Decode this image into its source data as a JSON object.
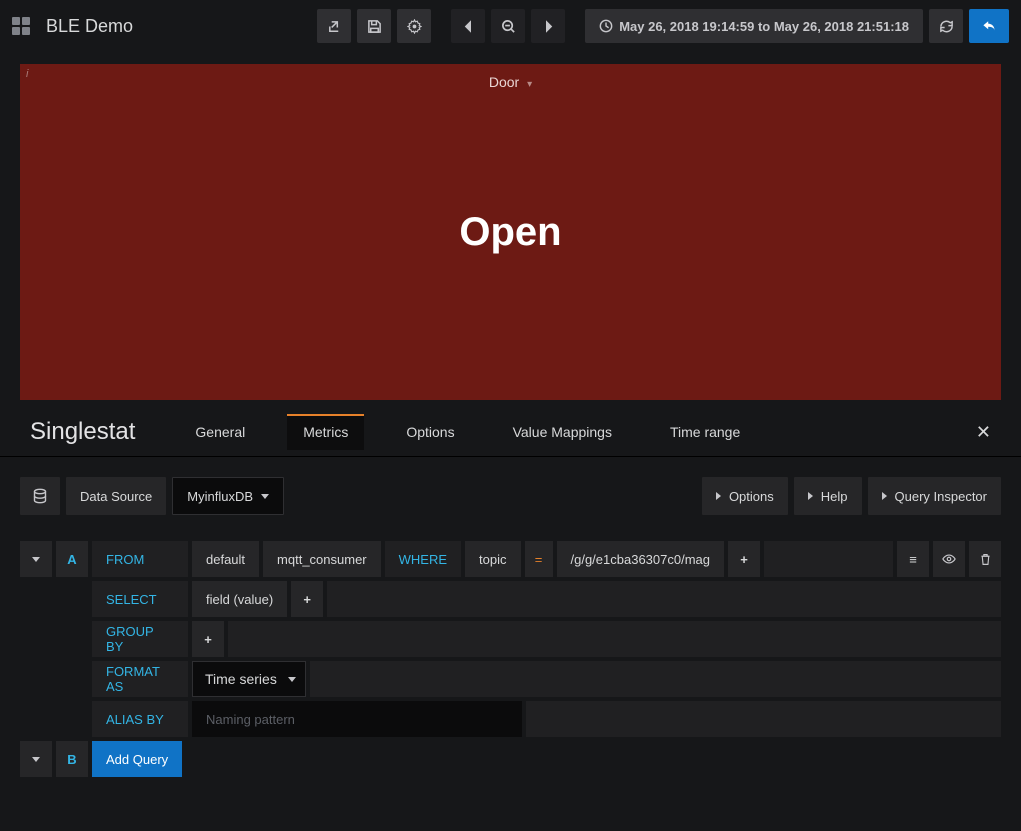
{
  "header": {
    "title": "BLE Demo",
    "timerange": "May 26, 2018 19:14:59 to May 26, 2018 21:51:18"
  },
  "panel": {
    "title": "Door",
    "value": "Open",
    "info_glyph": "i",
    "bg_color": "#6d1a14"
  },
  "editor": {
    "type_label": "Singlestat",
    "tabs": [
      "General",
      "Metrics",
      "Options",
      "Value Mappings",
      "Time range"
    ],
    "active_tab": "Metrics"
  },
  "datasource_row": {
    "label": "Data Source",
    "selected": "MyinfluxDB",
    "options_btn": "Options",
    "help_btn": "Help",
    "inspector_btn": "Query Inspector"
  },
  "query_a": {
    "letter": "A",
    "from_label": "FROM",
    "retention": "default",
    "measurement": "mqtt_consumer",
    "where_label": "WHERE",
    "where_key": "topic",
    "where_op": "=",
    "where_value": "/g/g/e1cba36307c0/mag",
    "select_label": "SELECT",
    "select_value": "field (value)",
    "groupby_label": "GROUP BY",
    "format_label": "FORMAT AS",
    "format_value": "Time series",
    "alias_label": "ALIAS BY",
    "alias_placeholder": "Naming pattern"
  },
  "query_b": {
    "letter": "B",
    "add_label": "Add Query"
  }
}
